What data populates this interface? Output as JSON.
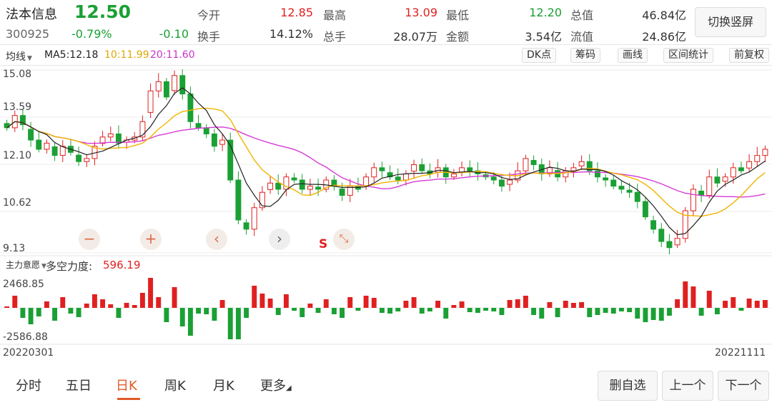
{
  "header": {
    "name": "法本信息",
    "price": "12.50",
    "code": "300925",
    "change_pct": "-0.79%",
    "change": "-0.10",
    "quotes": [
      {
        "label": "今开",
        "value": "12.85",
        "tone": "red"
      },
      {
        "label": "最高",
        "value": "13.09",
        "tone": "red"
      },
      {
        "label": "最低",
        "value": "12.20",
        "tone": "green"
      },
      {
        "label": "总值",
        "value": "46.84亿",
        "tone": "black"
      },
      {
        "label": "换手",
        "value": "14.12%",
        "tone": "black"
      },
      {
        "label": "总手",
        "value": "28.07万",
        "tone": "black"
      },
      {
        "label": "金额",
        "value": "3.54亿",
        "tone": "black"
      },
      {
        "label": "流值",
        "value": "24.86亿",
        "tone": "black"
      }
    ],
    "switch_label": "切换竖屏"
  },
  "toolbar": {
    "ma_type": "均线",
    "ma5": "MA5:12.18",
    "ma10": "10:11.99",
    "ma20": "20:11.60",
    "buttons": [
      "DK点",
      "筹码",
      "画线",
      "区间统计",
      "前复权"
    ]
  },
  "colors": {
    "up": "#e02020",
    "down": "#1aa034",
    "ma5": "#222222",
    "ma10": "#f0b400",
    "ma20": "#d63ad6",
    "accent": "#e05a2a"
  },
  "chart": {
    "y_labels": [
      "15.08",
      "13.59",
      "12.10",
      "10.62",
      "9.13"
    ],
    "date_start": "20220301",
    "date_end": "20221111",
    "controls": {
      "zoom_out": "−",
      "zoom_in": "+",
      "prev": "‹",
      "next": "›",
      "s_label": "S",
      "fullscreen": "⤡"
    }
  },
  "indicator": {
    "type": "主力意愿",
    "name": "多空力度:",
    "value": "596.19",
    "y_top": "2468.85",
    "y_bottom": "-2586.88"
  },
  "tabs": {
    "items": [
      "分时",
      "五日",
      "日K",
      "周K",
      "月K",
      "更多"
    ],
    "active": 2,
    "more_marker": "◢"
  },
  "actions": {
    "delete": "删自选",
    "prev": "上一个",
    "next": "下一个"
  },
  "chart_data": {
    "type": "candlestick",
    "x_start": "20220301",
    "x_end": "20221111",
    "ylim": [
      9.13,
      15.08
    ],
    "close": [
      13.2,
      13.6,
      13.3,
      12.8,
      12.5,
      12.7,
      12.3,
      12.6,
      12.4,
      12.1,
      12.2,
      12.6,
      12.9,
      13.0,
      12.7,
      12.8,
      12.9,
      13.4,
      14.4,
      14.7,
      14.2,
      14.9,
      14.3,
      13.4,
      13.2,
      13.0,
      12.6,
      12.8,
      11.5,
      10.2,
      9.9,
      10.6,
      11.1,
      11.4,
      11.2,
      11.6,
      11.5,
      11.2,
      11.3,
      11.2,
      11.5,
      11.3,
      11.0,
      11.3,
      11.2,
      11.6,
      11.9,
      11.8,
      11.6,
      11.5,
      11.7,
      12.0,
      11.8,
      11.7,
      11.9,
      11.6,
      11.7,
      11.9,
      11.8,
      11.7,
      11.6,
      11.5,
      11.3,
      11.5,
      11.8,
      12.2,
      12.0,
      11.7,
      11.9,
      11.6,
      11.8,
      11.9,
      12.1,
      11.8,
      11.6,
      11.5,
      11.3,
      11.2,
      11.1,
      10.8,
      10.3,
      9.9,
      9.5,
      9.3,
      9.6,
      10.5,
      11.2,
      11.0,
      11.6,
      11.4,
      11.6,
      11.9,
      11.8,
      12.1,
      12.3,
      12.5
    ]
  }
}
